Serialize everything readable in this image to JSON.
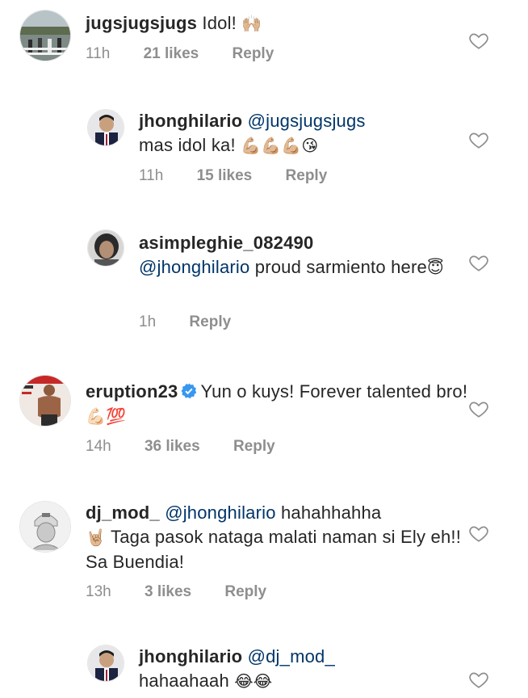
{
  "comments": [
    {
      "username": "jugsjugsjugs",
      "text": "Idol!",
      "emoji": "🙌🏼",
      "time": "11h",
      "likes": "21 likes",
      "reply": "Reply"
    },
    {
      "username": "jhonghilario",
      "mention": "@jugsjugsjugs",
      "text": "mas idol ka!",
      "emoji": "💪🏼💪🏼💪🏼😘",
      "time": "11h",
      "likes": "15 likes",
      "reply": "Reply"
    },
    {
      "username": "asimpleghie_082490",
      "mention": "@jhonghilario",
      "text": "proud sarmiento here",
      "emoji": "😇",
      "time": "1h",
      "reply": "Reply"
    },
    {
      "username": "eruption23",
      "text": "Yun o kuys! Forever talented bro!",
      "emoji": "💪🏻💯",
      "time": "14h",
      "likes": "36 likes",
      "reply": "Reply"
    },
    {
      "username": "dj_mod_",
      "mention": "@jhonghilario",
      "text_a": "hahahhahha",
      "emoji": "🤘🏼",
      "text_b": "Taga pasok nataga malati naman si Ely eh!! Sa Buendia!",
      "time": "13h",
      "likes": "3 likes",
      "reply": "Reply"
    },
    {
      "username": "jhonghilario",
      "mention": "@dj_mod_",
      "text": "hahaahaah",
      "emoji": "😂😂"
    }
  ],
  "colors": {
    "text": "#262626",
    "meta": "#8e8e8e",
    "mention": "#003569",
    "verified": "#3897f0"
  }
}
